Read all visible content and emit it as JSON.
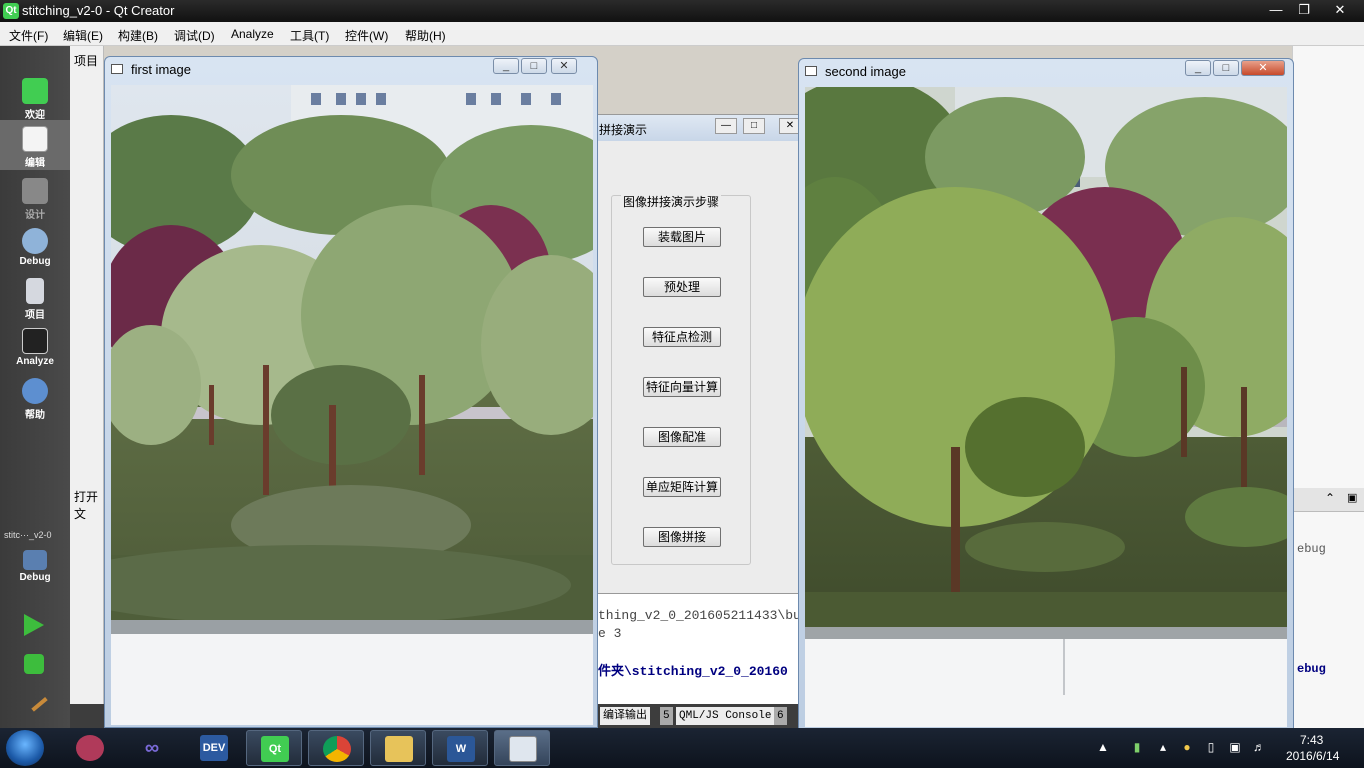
{
  "qt_window": {
    "title": "stitching_v2-0 - Qt Creator",
    "logo_text": "Qt",
    "menus": [
      "文件(F)",
      "编辑(E)",
      "构建(B)",
      "调试(D)",
      "Analyze",
      "工具(T)",
      "控件(W)",
      "帮助(H)"
    ],
    "modes": [
      {
        "label": "欢迎",
        "icon": "qt-welcome-icon"
      },
      {
        "label": "编辑",
        "icon": "edit-icon"
      },
      {
        "label": "设计",
        "icon": "design-icon"
      },
      {
        "label": "Debug",
        "icon": "debug-icon"
      },
      {
        "label": "项目",
        "icon": "project-icon"
      },
      {
        "label": "Analyze",
        "icon": "analyze-icon"
      },
      {
        "label": "帮助",
        "icon": "help-icon"
      }
    ],
    "kit_label": "stitc···_v2-0",
    "kit_mode": "Debug",
    "sidebar_header": "项目",
    "open_docs_header": "打开文",
    "right_output_lines": [
      "ebug",
      "ebug"
    ]
  },
  "dialog": {
    "title": "拼接演示",
    "group_title": "图像拼接演示步骤",
    "buttons": [
      "装载图片",
      "预处理",
      "特征点检测",
      "特征向量计算",
      "图像配准",
      "单应矩阵计算",
      "图像拼接"
    ]
  },
  "output": {
    "lines": [
      "thing_v2_0_201605211433\\bu",
      "e 3",
      "件夹\\stitching_v2_0_20160"
    ],
    "tabs": [
      "编译输出",
      "5",
      "QML/JS Console",
      "6"
    ]
  },
  "first_window": {
    "title": "first image"
  },
  "second_window": {
    "title": "second image"
  },
  "taskbar": {
    "apps": [
      "dev-cpp-icon",
      "visual-studio-icon",
      "dev-express-icon",
      "qt-creator-icon",
      "chrome-icon",
      "file-explorer-icon",
      "word-icon",
      "app-window-icon"
    ],
    "dev_label": "DEV",
    "time": "7:43",
    "date": "2016/6/14"
  }
}
